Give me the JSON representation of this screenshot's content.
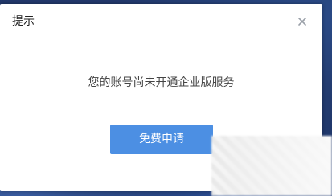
{
  "dialog": {
    "title": "提示",
    "close_icon": "close-icon",
    "message": "您的账号尚未开通企业版服务",
    "apply_label": "免费申请"
  },
  "colors": {
    "button_bg": "#4c8fe3",
    "backdrop": "#1c2f5c"
  }
}
